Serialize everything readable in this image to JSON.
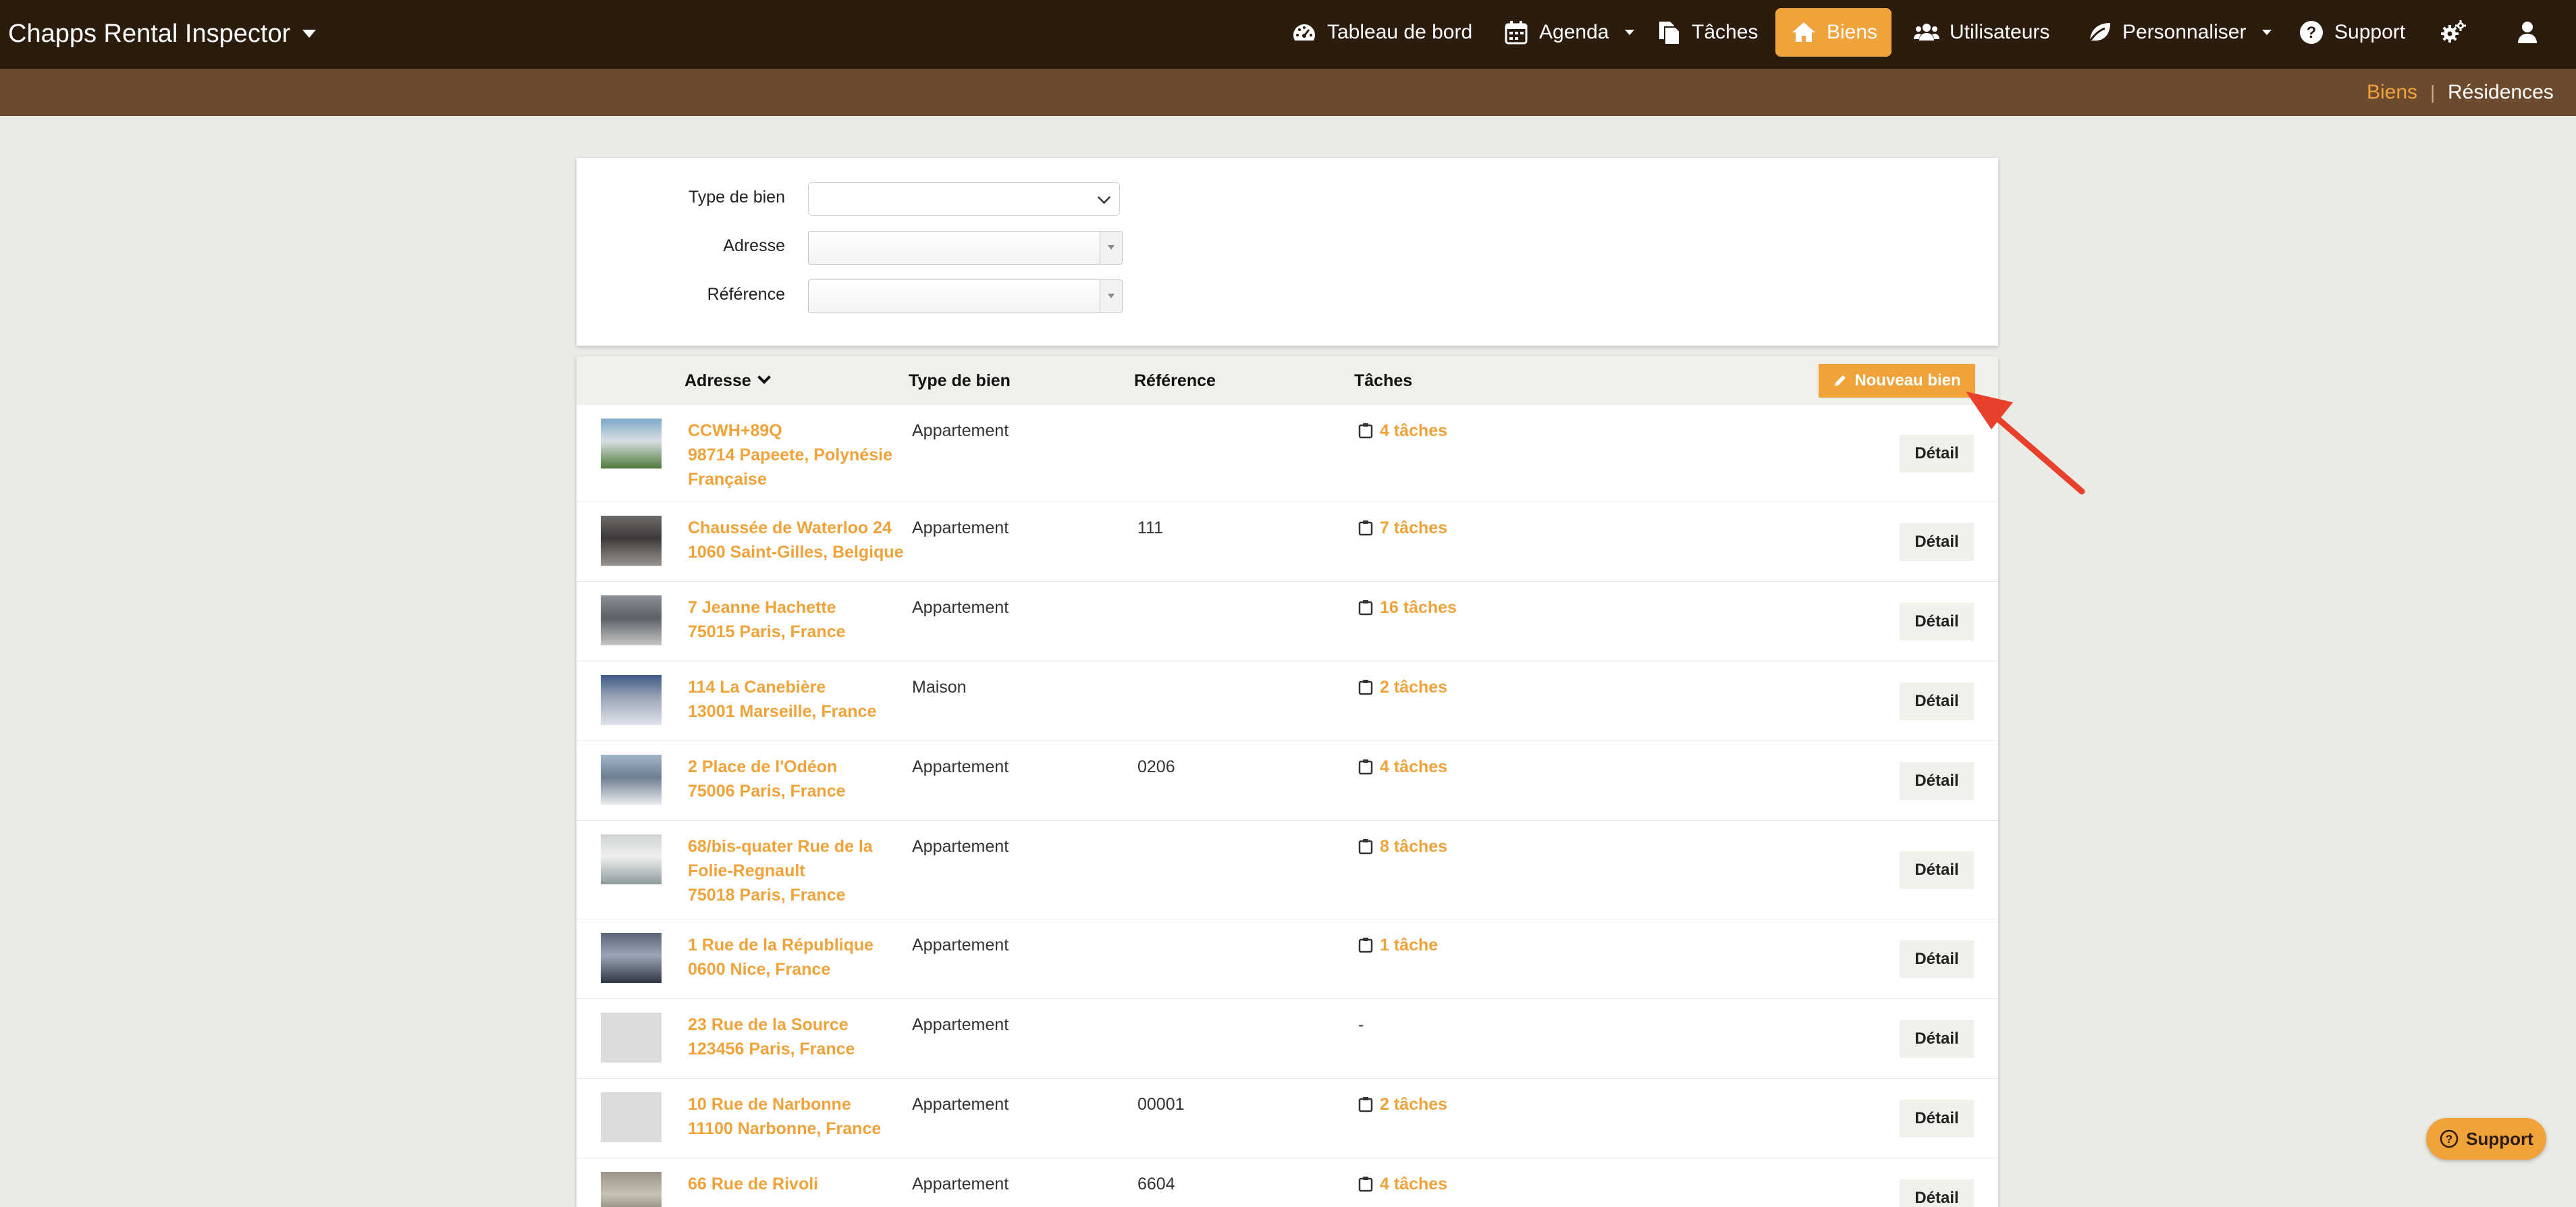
{
  "app": {
    "title": "Chapps Rental Inspector"
  },
  "nav": {
    "dashboard": "Tableau de bord",
    "agenda": "Agenda",
    "tasks": "Tâches",
    "properties": "Biens",
    "users": "Utilisateurs",
    "customize": "Personnaliser",
    "support": "Support"
  },
  "subnav": {
    "properties": "Biens",
    "residences": "Résidences"
  },
  "filters": {
    "type_label": "Type de bien",
    "address_label": "Adresse",
    "reference_label": "Référence"
  },
  "table": {
    "col_address": "Adresse",
    "col_type": "Type de bien",
    "col_reference": "Référence",
    "col_tasks": "Tâches",
    "new_button": "Nouveau bien",
    "detail_label": "Détail",
    "rows": [
      {
        "address": "CCWH+89Q\n98714 Papeete, Polynésie\nFrançaise",
        "type": "Appartement",
        "reference": "",
        "tasks": "4 tâches"
      },
      {
        "address": "Chaussée de Waterloo 24\n1060 Saint-Gilles, Belgique",
        "type": "Appartement",
        "reference": "111",
        "tasks": "7 tâches"
      },
      {
        "address": "7 Jeanne Hachette\n75015 Paris, France",
        "type": "Appartement",
        "reference": "",
        "tasks": "16 tâches"
      },
      {
        "address": "114 La Canebière\n13001 Marseille, France",
        "type": "Maison",
        "reference": "",
        "tasks": "2 tâches"
      },
      {
        "address": "2 Place de l'Odéon\n75006 Paris, France",
        "type": "Appartement",
        "reference": "0206",
        "tasks": "4 tâches"
      },
      {
        "address": "68/bis-quater Rue de la\nFolie-Regnault\n75018 Paris, France",
        "type": "Appartement",
        "reference": "",
        "tasks": "8 tâches"
      },
      {
        "address": "1 Rue de la République\n0600 Nice, France",
        "type": "Appartement",
        "reference": "",
        "tasks": "1 tâche"
      },
      {
        "address": "23 Rue de la Source\n123456 Paris, France",
        "type": "Appartement",
        "reference": "",
        "tasks": "-"
      },
      {
        "address": "10 Rue de Narbonne\n11100 Narbonne, France",
        "type": "Appartement",
        "reference": "00001",
        "tasks": "2 tâches"
      },
      {
        "address": "66 Rue de Rivoli",
        "type": "Appartement",
        "reference": "6604",
        "tasks": "4 tâches"
      }
    ]
  },
  "support_button": "Support",
  "colors": {
    "accent": "#f0a33b",
    "topbar": "#2b1c0e",
    "subbar": "#6b4a2e",
    "annotation": "#e8402a"
  },
  "icons": {
    "dashboard": "gauge-icon",
    "agenda": "calendar-icon",
    "tasks": "copy-icon",
    "properties": "home-icon",
    "users": "users-icon",
    "customize": "leaf-icon",
    "support": "question-circle-icon",
    "settings": "cogs-icon",
    "account": "user-icon",
    "new": "pencil-icon",
    "row_tasks": "clipboard-icon"
  }
}
